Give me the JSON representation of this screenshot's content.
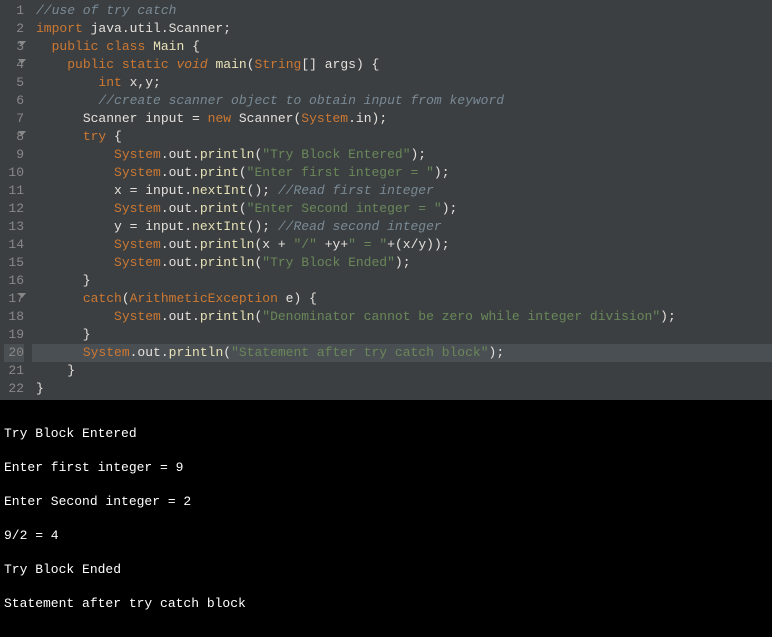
{
  "editor": {
    "lines": {
      "l1": "//use of try catch",
      "l2_import": "import",
      "l2_pkg": " java.util.Scanner;",
      "l3_public": "public",
      "l3_class": "class",
      "l3_name": "Main",
      "l4_public": "public",
      "l4_static": "static",
      "l4_void": "void",
      "l4_main": "main",
      "l4_string": "String",
      "l4_args": "[] args",
      "l5_int": "int",
      "l5_vars": " x,y;",
      "l6": "//create scanner object to obtain input from keyword",
      "l7_scanner": "Scanner",
      "l7_input": " input ",
      "l7_eq": "=",
      "l7_new": "new",
      "l7_scanner2": "Scanner",
      "l7_system": "System",
      "l7_in": ".in",
      "l8_try": "try",
      "l9_system": "System",
      "l9_out": ".out.",
      "l9_println": "println",
      "l9_str": "\"Try Block Entered\"",
      "l10_system": "System",
      "l10_out": ".out.",
      "l10_print": "print",
      "l10_str": "\"Enter first integer = \"",
      "l11_x": "x ",
      "l11_eq": "=",
      "l11_input": " input.",
      "l11_nextint": "nextInt",
      "l11_comment": "//Read first integer",
      "l12_system": "System",
      "l12_out": ".out.",
      "l12_print": "print",
      "l12_str": "\"Enter Second integer = \"",
      "l13_y": "y ",
      "l13_eq": "=",
      "l13_input": " input.",
      "l13_nextint": "nextInt",
      "l13_comment": "//Read second integer",
      "l14_system": "System",
      "l14_out": ".out.",
      "l14_println": "println",
      "l14_expr1": "x ",
      "l14_plus1": "+",
      "l14_str1": " \"/\" ",
      "l14_plus2": "+",
      "l14_y": "y",
      "l14_plus3": "+",
      "l14_str2": "\" = \"",
      "l14_plus4": "+",
      "l14_expr2": "(x/y)",
      "l15_system": "System",
      "l15_out": ".out.",
      "l15_println": "println",
      "l15_str": "\"Try Block Ended\"",
      "l17_catch": "catch",
      "l17_exc": "ArithmeticException",
      "l17_e": " e",
      "l18_system": "System",
      "l18_out": ".out.",
      "l18_println": "println",
      "l18_str": "\"Denominator cannot be zero while integer division\"",
      "l20_system": "System",
      "l20_out": ".out.",
      "l20_println": "println",
      "l20_str": "\"Statement after try catch block\""
    },
    "gutter": [
      "1",
      "2",
      "3",
      "4",
      "5",
      "6",
      "7",
      "8",
      "9",
      "10",
      "11",
      "12",
      "13",
      "14",
      "15",
      "16",
      "17",
      "18",
      "19",
      "20",
      "21",
      "22"
    ]
  },
  "console": {
    "line1": "Try Block Entered",
    "line2": "Enter first integer = 9",
    "line3": "Enter Second integer = 2",
    "line4": "9/2 = 4",
    "line5": "Try Block Ended",
    "line6": "Statement after try catch block"
  }
}
